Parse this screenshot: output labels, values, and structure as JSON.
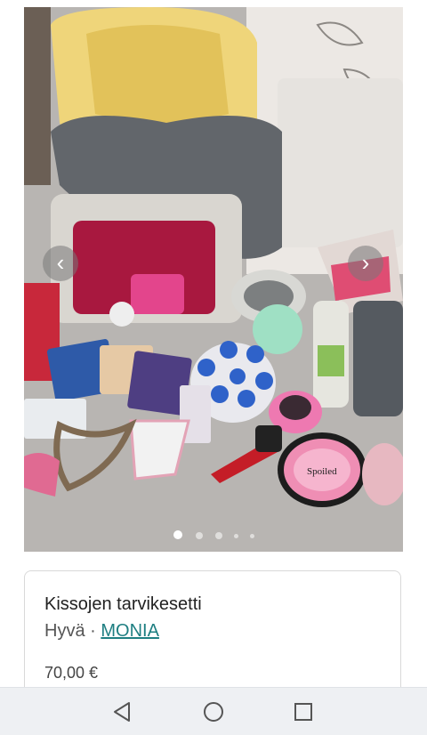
{
  "listing": {
    "title": "Kissojen tarvikesetti",
    "condition": "Hyvä",
    "separator": " · ",
    "brand": "MONIA",
    "price": "70,00 €"
  },
  "carousel": {
    "prev_glyph": "‹",
    "next_glyph": "›",
    "image_count": 5,
    "active_index": 0
  },
  "product_labels": {
    "bowl_text": "Spoiled"
  },
  "icons": [
    "chevron-left-icon",
    "chevron-right-icon",
    "back-triangle-icon",
    "home-circle-icon",
    "recents-square-icon"
  ]
}
